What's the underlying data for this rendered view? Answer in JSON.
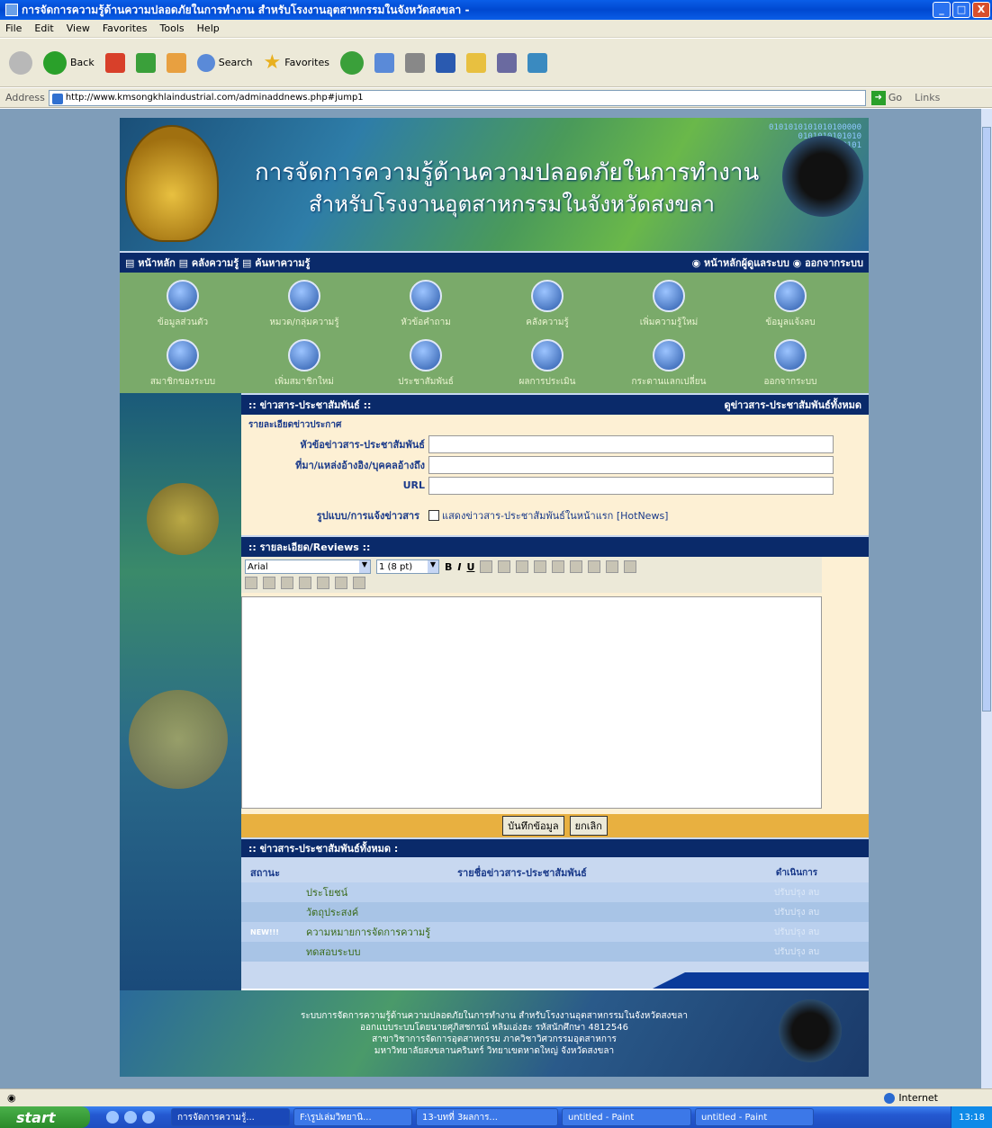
{
  "window": {
    "title": "การจัดการความรู้ด้านความปลอดภัยในการทำงาน สำหรับโรงงานอุตสาหกรรมในจังหวัดสงขลา -",
    "minimize": "_",
    "maximize": "□",
    "close": "X"
  },
  "menu": [
    "File",
    "Edit",
    "View",
    "Favorites",
    "Tools",
    "Help"
  ],
  "toolbar": {
    "back": "Back",
    "search": "Search",
    "favorites": "Favorites"
  },
  "address": {
    "label": "Address",
    "url": "http://www.kmsongkhlaindustrial.com/adminaddnews.php#jump1",
    "go": "Go",
    "links": "Links"
  },
  "banner": {
    "title1": "การจัดการความรู้ด้านความปลอดภัยในการทำงาน",
    "title2": "สำหรับโรงงานอุตสาหกรรมในจังหวัดสงขลา",
    "binary": "0101010101010100000\n0101010101010\n0101010101"
  },
  "nav": {
    "left": "▤ หน้าหลัก ▤ คลังความรู้ ▤ ค้นหาความรู้",
    "right": "◉ หน้าหลักผู้ดูแลระบบ ◉ ออกจากระบบ"
  },
  "icons": [
    {
      "label": "ข้อมูลส่วนตัว",
      "icon": "user-icon"
    },
    {
      "label": "หมวด/กลุ่มความรู้",
      "icon": "folder-icon"
    },
    {
      "label": "หัวข้อคำถาม",
      "icon": "question-icon"
    },
    {
      "label": "คลังความรู้",
      "icon": "database-icon"
    },
    {
      "label": "เพิ่มความรู้ใหม่",
      "icon": "edit-icon"
    },
    {
      "label": "ข้อมูลแจ้งลบ",
      "icon": "eraser-icon"
    },
    {
      "label": "สมาชิกของระบบ",
      "icon": "members-icon"
    },
    {
      "label": "เพิ่มสมาชิกใหม่",
      "icon": "add-member-icon"
    },
    {
      "label": "ประชาสัมพันธ์",
      "icon": "news-icon"
    },
    {
      "label": "ผลการประเมิน",
      "icon": "report-icon"
    },
    {
      "label": "กระดานแลกเปลี่ยน",
      "icon": "board-icon"
    },
    {
      "label": "ออกจากระบบ",
      "icon": "logout-icon"
    }
  ],
  "news_form": {
    "header": ":: ข่าวสาร-ประชาสัมพันธ์ ::",
    "header_link": "ดูข่าวสาร-ประชาสัมพันธ์ทั้งหมด",
    "section_label": "รายละเอียดข่าวประกาศ",
    "title_label": "หัวข้อข่าวสาร-ประชาสัมพันธ์",
    "source_label": "ที่มา/แหล่งอ้างอิง/บุคคลอ้างถึง",
    "url_label": "URL",
    "format_label": "รูปแบบ/การแจ้งข่าวสาร",
    "hotnews_label": "แสดงข่าวสาร-ประชาสัมพันธ์ในหน้าแรก [HotNews]"
  },
  "reviews": {
    "header": ":: รายละเอียด/Reviews ::",
    "font": "Arial",
    "size": "1 (8 pt)",
    "bold": "B",
    "italic": "I",
    "underline": "U"
  },
  "buttons": {
    "save": "บันทึกข้อมูล",
    "cancel": "ยกเลิก"
  },
  "list": {
    "header": ":: ข่าวสาร-ประชาสัมพันธ์ทั้งหมด :",
    "columns": [
      "สถานะ",
      "รายชื่อข่าวสาร-ประชาสัมพันธ์",
      "ดำเนินการ"
    ],
    "rows": [
      {
        "status": "",
        "title": "ประโยชน์",
        "action": "ปรับปรุง  ลบ"
      },
      {
        "status": "",
        "title": "วัตถุประสงค์",
        "action": "ปรับปรุง  ลบ"
      },
      {
        "status": "NEW!!!",
        "title": "ความหมายการจัดการความรู้",
        "action": "ปรับปรุง  ลบ"
      },
      {
        "status": "",
        "title": "ทดสอบระบบ",
        "action": "ปรับปรุง  ลบ"
      }
    ]
  },
  "footer": {
    "line1": "ระบบการจัดการความรู้ด้านความปลอดภัยในการทำงาน สำหรับโรงงานอุตสาหกรรมในจังหวัดสงขลา",
    "line2": "ออกแบบระบบโดยนายศุภิสชกรณ์ หลิมเอ่งฮะ รหัสนักศึกษา 4812546",
    "line3": "สาขาวิชาการจัดการอุตสาหกรรม ภาควิชาวิศวกรรมอุตสาหการ",
    "line4": "มหาวิทยาลัยสงขลานครินทร์ วิทยาเขตหาดใหญ่ จังหวัดสงขลา"
  },
  "status": {
    "zone": "Internet"
  },
  "taskbar": {
    "start": "start",
    "tasks": [
      "การจัดการความรู้...",
      "F:\\รูปเล่มวิทยานิ...",
      "13-บทที่ 3ผลการ...",
      "untitled - Paint",
      "untitled - Paint"
    ],
    "clock": "13:18"
  },
  "colors": {
    "nav_bg": "#0a2a6a",
    "icon_panel": "#7aaa6a",
    "form_bg": "#fdf0d4",
    "button_bar": "#e8b040",
    "table_bg": "#c8d8f0"
  }
}
